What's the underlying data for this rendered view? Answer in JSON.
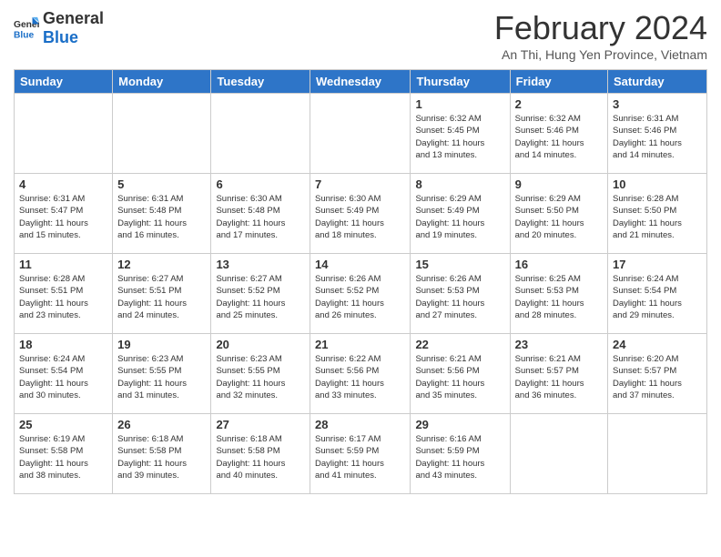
{
  "logo": {
    "general": "General",
    "blue": "Blue"
  },
  "header": {
    "title": "February 2024",
    "subtitle": "An Thi, Hung Yen Province, Vietnam"
  },
  "weekdays": [
    "Sunday",
    "Monday",
    "Tuesday",
    "Wednesday",
    "Thursday",
    "Friday",
    "Saturday"
  ],
  "weeks": [
    [
      {
        "day": "",
        "info": ""
      },
      {
        "day": "",
        "info": ""
      },
      {
        "day": "",
        "info": ""
      },
      {
        "day": "",
        "info": ""
      },
      {
        "day": "1",
        "info": "Sunrise: 6:32 AM\nSunset: 5:45 PM\nDaylight: 11 hours\nand 13 minutes."
      },
      {
        "day": "2",
        "info": "Sunrise: 6:32 AM\nSunset: 5:46 PM\nDaylight: 11 hours\nand 14 minutes."
      },
      {
        "day": "3",
        "info": "Sunrise: 6:31 AM\nSunset: 5:46 PM\nDaylight: 11 hours\nand 14 minutes."
      }
    ],
    [
      {
        "day": "4",
        "info": "Sunrise: 6:31 AM\nSunset: 5:47 PM\nDaylight: 11 hours\nand 15 minutes."
      },
      {
        "day": "5",
        "info": "Sunrise: 6:31 AM\nSunset: 5:48 PM\nDaylight: 11 hours\nand 16 minutes."
      },
      {
        "day": "6",
        "info": "Sunrise: 6:30 AM\nSunset: 5:48 PM\nDaylight: 11 hours\nand 17 minutes."
      },
      {
        "day": "7",
        "info": "Sunrise: 6:30 AM\nSunset: 5:49 PM\nDaylight: 11 hours\nand 18 minutes."
      },
      {
        "day": "8",
        "info": "Sunrise: 6:29 AM\nSunset: 5:49 PM\nDaylight: 11 hours\nand 19 minutes."
      },
      {
        "day": "9",
        "info": "Sunrise: 6:29 AM\nSunset: 5:50 PM\nDaylight: 11 hours\nand 20 minutes."
      },
      {
        "day": "10",
        "info": "Sunrise: 6:28 AM\nSunset: 5:50 PM\nDaylight: 11 hours\nand 21 minutes."
      }
    ],
    [
      {
        "day": "11",
        "info": "Sunrise: 6:28 AM\nSunset: 5:51 PM\nDaylight: 11 hours\nand 23 minutes."
      },
      {
        "day": "12",
        "info": "Sunrise: 6:27 AM\nSunset: 5:51 PM\nDaylight: 11 hours\nand 24 minutes."
      },
      {
        "day": "13",
        "info": "Sunrise: 6:27 AM\nSunset: 5:52 PM\nDaylight: 11 hours\nand 25 minutes."
      },
      {
        "day": "14",
        "info": "Sunrise: 6:26 AM\nSunset: 5:52 PM\nDaylight: 11 hours\nand 26 minutes."
      },
      {
        "day": "15",
        "info": "Sunrise: 6:26 AM\nSunset: 5:53 PM\nDaylight: 11 hours\nand 27 minutes."
      },
      {
        "day": "16",
        "info": "Sunrise: 6:25 AM\nSunset: 5:53 PM\nDaylight: 11 hours\nand 28 minutes."
      },
      {
        "day": "17",
        "info": "Sunrise: 6:24 AM\nSunset: 5:54 PM\nDaylight: 11 hours\nand 29 minutes."
      }
    ],
    [
      {
        "day": "18",
        "info": "Sunrise: 6:24 AM\nSunset: 5:54 PM\nDaylight: 11 hours\nand 30 minutes."
      },
      {
        "day": "19",
        "info": "Sunrise: 6:23 AM\nSunset: 5:55 PM\nDaylight: 11 hours\nand 31 minutes."
      },
      {
        "day": "20",
        "info": "Sunrise: 6:23 AM\nSunset: 5:55 PM\nDaylight: 11 hours\nand 32 minutes."
      },
      {
        "day": "21",
        "info": "Sunrise: 6:22 AM\nSunset: 5:56 PM\nDaylight: 11 hours\nand 33 minutes."
      },
      {
        "day": "22",
        "info": "Sunrise: 6:21 AM\nSunset: 5:56 PM\nDaylight: 11 hours\nand 35 minutes."
      },
      {
        "day": "23",
        "info": "Sunrise: 6:21 AM\nSunset: 5:57 PM\nDaylight: 11 hours\nand 36 minutes."
      },
      {
        "day": "24",
        "info": "Sunrise: 6:20 AM\nSunset: 5:57 PM\nDaylight: 11 hours\nand 37 minutes."
      }
    ],
    [
      {
        "day": "25",
        "info": "Sunrise: 6:19 AM\nSunset: 5:58 PM\nDaylight: 11 hours\nand 38 minutes."
      },
      {
        "day": "26",
        "info": "Sunrise: 6:18 AM\nSunset: 5:58 PM\nDaylight: 11 hours\nand 39 minutes."
      },
      {
        "day": "27",
        "info": "Sunrise: 6:18 AM\nSunset: 5:58 PM\nDaylight: 11 hours\nand 40 minutes."
      },
      {
        "day": "28",
        "info": "Sunrise: 6:17 AM\nSunset: 5:59 PM\nDaylight: 11 hours\nand 41 minutes."
      },
      {
        "day": "29",
        "info": "Sunrise: 6:16 AM\nSunset: 5:59 PM\nDaylight: 11 hours\nand 43 minutes."
      },
      {
        "day": "",
        "info": ""
      },
      {
        "day": "",
        "info": ""
      }
    ]
  ]
}
